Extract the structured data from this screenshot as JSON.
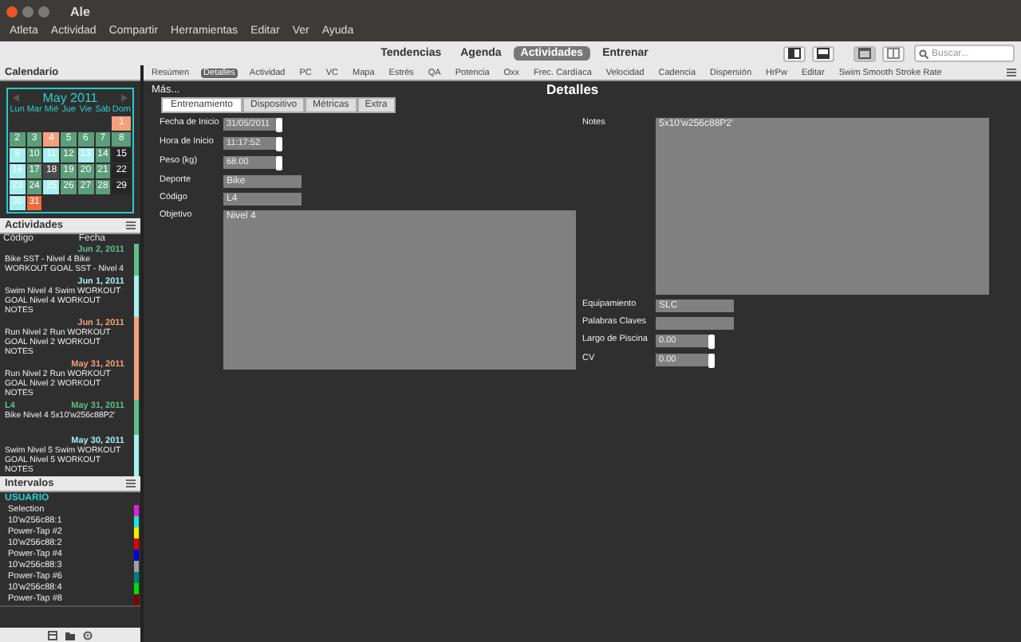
{
  "window": {
    "title": "Ale"
  },
  "menu": [
    "Atleta",
    "Actividad",
    "Compartir",
    "Herramientas",
    "Editar",
    "Ver",
    "Ayuda"
  ],
  "views": [
    {
      "label": "Tendencias",
      "selected": false
    },
    {
      "label": "Agenda",
      "selected": false
    },
    {
      "label": "Actividades",
      "selected": true
    },
    {
      "label": "Entrenar",
      "selected": false
    }
  ],
  "toolbar_buttons": [
    {
      "kind": "left-panel",
      "selected": false
    },
    {
      "kind": "bottom-panel",
      "selected": false
    },
    {
      "kind": "single",
      "selected": true
    },
    {
      "kind": "split",
      "selected": false
    }
  ],
  "search": {
    "placeholder": "Buscar..."
  },
  "calendar": {
    "header": "Calendario",
    "month": "May 2011",
    "weekdays": [
      "Lun",
      "Mar",
      "Mié",
      "Jue",
      "Vie",
      "Sáb",
      "Dom"
    ],
    "weeks": [
      [
        {
          "day": "1",
          "color": "#f4a07a"
        }
      ],
      [
        {
          "day": "2",
          "color": "#5c9e7a"
        },
        {
          "day": "3",
          "color": "#5c9e7a"
        },
        {
          "day": "4",
          "color": "#f4a07a"
        },
        {
          "day": "5",
          "color": "#5c9e7a"
        },
        {
          "day": "6",
          "color": "#5c9e7a"
        },
        {
          "day": "7",
          "color": "#5c9e7a"
        },
        {
          "day": "8",
          "color": "#5c9e7a"
        }
      ],
      [
        {
          "day": "9",
          "color": "#a8f0f0"
        },
        {
          "day": "10",
          "color": "#5c9e7a"
        },
        {
          "day": "11",
          "color": "#a8f0f0"
        },
        {
          "day": "12",
          "color": "#5c9e7a"
        },
        {
          "day": "13",
          "color": "#a8f0f0"
        },
        {
          "day": "14",
          "color": "#5c9e7a"
        },
        {
          "day": "15",
          "color": "#262626"
        }
      ],
      [
        {
          "day": "16",
          "color": "#a8f0f0"
        },
        {
          "day": "17",
          "color": "#5c9e7a"
        },
        {
          "day": "18",
          "color": "#4a4a4a"
        },
        {
          "day": "19",
          "color": "#5c9e7a"
        },
        {
          "day": "20",
          "color": "#5c9e7a"
        },
        {
          "day": "21",
          "color": "#5c9e7a"
        },
        {
          "day": "22",
          "color": "#262626"
        }
      ],
      [
        {
          "day": "23",
          "color": "#a8f0f0"
        },
        {
          "day": "24",
          "color": "#5c9e7a"
        },
        {
          "day": "25",
          "color": "#a8f0f0"
        },
        {
          "day": "26",
          "color": "#5c9e7a"
        },
        {
          "day": "27",
          "color": "#5c9e7a"
        },
        {
          "day": "28",
          "color": "#5c9e7a"
        },
        {
          "day": "29",
          "color": "#262626"
        }
      ],
      [
        {
          "day": "30",
          "color": "#a8f0f0"
        },
        {
          "day": "31",
          "color": "#f06a3a"
        }
      ]
    ]
  },
  "activities": {
    "header": "Actividades",
    "columns": [
      "Código",
      "Fecha"
    ],
    "items": [
      {
        "date": "Jun 2, 2011",
        "color": "#5cc08a",
        "text": "Bike SST - Nivel 4 Bike WORKOUT GOAL SST - Nivel 4"
      },
      {
        "date": "Jun 1, 2011",
        "color": "#a8f0f0",
        "text": "Swim Nivel 4 Swim  WORKOUT GOAL Nivel 4 WORKOUT NOTES"
      },
      {
        "date": "Jun 1, 2011",
        "color": "#f4a07a",
        "text": "Run Nivel 2 Run  WORKOUT GOAL Nivel 2 WORKOUT NOTES"
      },
      {
        "date": "May 31, 2011",
        "color": "#f4a07a",
        "text": "Run Nivel 2 Run  WORKOUT GOAL Nivel 2 WORKOUT NOTES"
      },
      {
        "code": "L4",
        "date": "May 31, 2011",
        "color": "#5cc08a",
        "text": "Bike Nivel 4 5x10'w256c88P2'"
      },
      {
        "date": "May 30, 2011",
        "color": "#a8f0f0",
        "text": "Swim Nivel 5 Swim  WORKOUT GOAL Nivel 5 WORKOUT NOTES"
      }
    ]
  },
  "intervals": {
    "header": "Intervalos",
    "group": "USUARIO",
    "items": [
      {
        "label": "Selection",
        "color": "#e020e0"
      },
      {
        "label": "10'w256c88:1",
        "color": "#20e0e0"
      },
      {
        "label": "Power-Tap #2",
        "color": "#f0f000"
      },
      {
        "label": "10'w256c88:2",
        "color": "#e00000"
      },
      {
        "label": "Power-Tap #4",
        "color": "#0000e0"
      },
      {
        "label": "10'w256c88:3",
        "color": "#a0a0a0"
      },
      {
        "label": "Power-Tap #6",
        "color": "#008080"
      },
      {
        "label": "10'w256c88:4",
        "color": "#00e000"
      },
      {
        "label": "Power-Tap #8",
        "color": "#800000"
      }
    ]
  },
  "detail_tabs": [
    {
      "label": "Resúmen",
      "selected": false
    },
    {
      "label": "Detalles",
      "selected": true
    },
    {
      "label": "Actividad",
      "selected": false
    },
    {
      "label": "PC",
      "selected": false
    },
    {
      "label": "VC",
      "selected": false
    },
    {
      "label": "Mapa",
      "selected": false
    },
    {
      "label": "Estrés",
      "selected": false
    },
    {
      "label": "QA",
      "selected": false
    },
    {
      "label": "Potencia",
      "selected": false
    },
    {
      "label": "Oxx",
      "selected": false
    },
    {
      "label": "Frec. Cardíaca",
      "selected": false
    },
    {
      "label": "Velocidad",
      "selected": false
    },
    {
      "label": "Cadencia",
      "selected": false
    },
    {
      "label": "Dispersión",
      "selected": false
    },
    {
      "label": "HrPw",
      "selected": false
    },
    {
      "label": "Editar",
      "selected": false
    },
    {
      "label": "Swim Smooth Stroke Rate",
      "selected": false
    }
  ],
  "detail": {
    "more": "Más...",
    "title": "Detalles",
    "tabs": [
      {
        "label": "Entrenamiento",
        "selected": true
      },
      {
        "label": "Dispositivo",
        "selected": false
      },
      {
        "label": "Métricas",
        "selected": false
      },
      {
        "label": "Extra",
        "selected": false
      }
    ],
    "left_fields": [
      {
        "label": "Fecha de Inicio",
        "value": "31/05/2011",
        "kind": "spin"
      },
      {
        "label": "Hora de Inicio",
        "value": "11:17:52",
        "kind": "spin"
      },
      {
        "label": "Peso (kg)",
        "value": "68.00",
        "kind": "spin"
      },
      {
        "label": "Deporte",
        "value": "Bike",
        "kind": "text"
      },
      {
        "label": "Código",
        "value": "L4",
        "kind": "text"
      },
      {
        "label": "Objetivo",
        "value": "Nivel 4",
        "kind": "textarea"
      }
    ],
    "notes": {
      "label": "Notes",
      "value": "5x10'w256c88P2'"
    },
    "right_fields": [
      {
        "label": "Equipamiento",
        "value": "SLC",
        "kind": "text"
      },
      {
        "label": "Palabras Claves",
        "kind": "text"
      },
      {
        "label": "Largo de Piscina",
        "value": "0.00",
        "kind": "spin"
      },
      {
        "label": "CV",
        "value": "0.00",
        "kind": "spin"
      }
    ]
  }
}
